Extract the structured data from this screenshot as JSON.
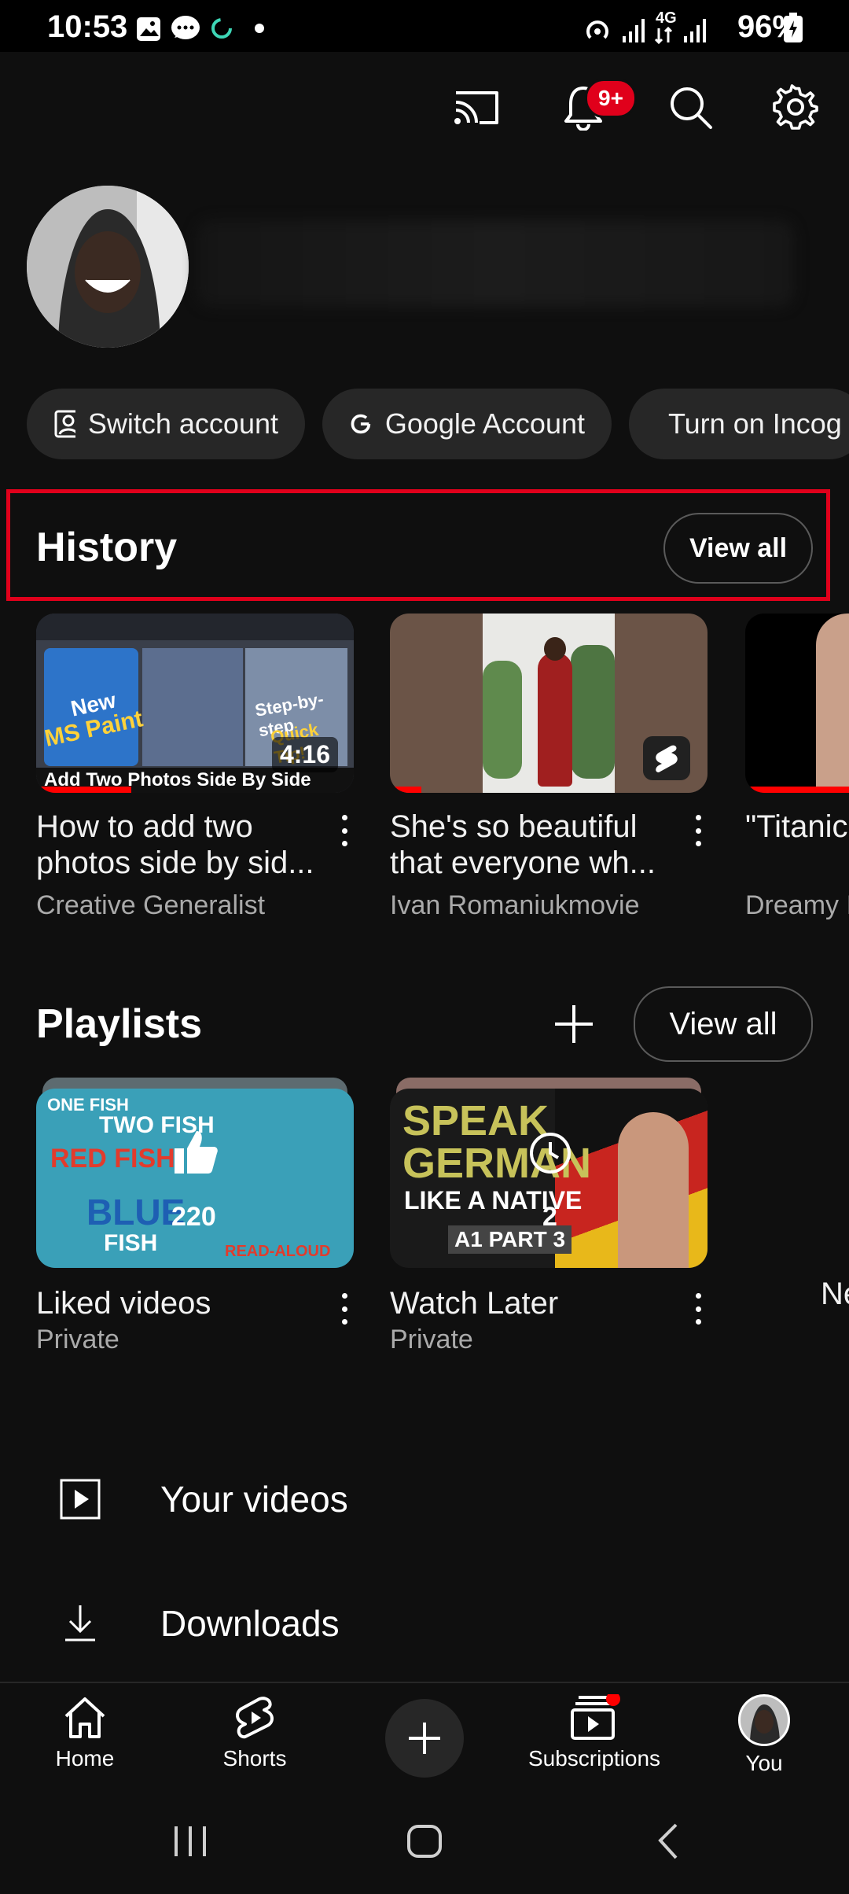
{
  "status_bar": {
    "time": "10:53",
    "battery": "96%",
    "network": "4G"
  },
  "top_bar": {
    "notification_badge": "9+"
  },
  "account_chips": [
    {
      "label": "Switch account",
      "icon": "person-card-icon"
    },
    {
      "label": "Google Account",
      "icon": "google-g-icon"
    },
    {
      "label": "Turn on Incog",
      "icon": "incognito-icon"
    }
  ],
  "history": {
    "title": "History",
    "view_all": "View all",
    "items": [
      {
        "title": "How to add two photos side by sid...",
        "channel": "Creative Generalist",
        "duration": "4:16",
        "progress": 0.3,
        "thumb_texts": {
          "line1": "New",
          "line2": "MS Paint",
          "line3": "Step-by-step",
          "line4": "Quick Tip!",
          "caption": "Add Two Photos Side By Side"
        }
      },
      {
        "title": "She's so beautiful that everyone wh...",
        "channel": "Ivan Romaniukmovie",
        "progress": 0.1
      },
      {
        "title": "\"Titanic screen\"",
        "channel": "Dreamy I"
      }
    ]
  },
  "playlists": {
    "title": "Playlists",
    "view_all": "View all",
    "items": [
      {
        "title": "Liked videos",
        "privacy": "Private",
        "count": "220",
        "thumb_texts": {
          "l1": "ONE FISH",
          "l2": "TWO FISH",
          "l3": "RED FISH",
          "l4": "BLUE",
          "l5": "FISH",
          "l6": "READ-ALOUD"
        }
      },
      {
        "title": "Watch Later",
        "privacy": "Private",
        "count": "2",
        "thumb_texts": {
          "l1": "SPEAK",
          "l2": "GERMAN",
          "l3": "LIKE A NATIVE",
          "l4": "A1 PART 3"
        }
      },
      {
        "title": "Ne"
      }
    ]
  },
  "menu": [
    {
      "label": "Your videos",
      "icon": "play-square-icon"
    },
    {
      "label": "Downloads",
      "icon": "download-icon"
    }
  ],
  "bottom_nav": [
    {
      "label": "Home",
      "icon": "home-icon"
    },
    {
      "label": "Shorts",
      "icon": "shorts-icon"
    },
    {
      "label": "",
      "icon": "create-plus-icon"
    },
    {
      "label": "Subscriptions",
      "icon": "subscriptions-icon"
    },
    {
      "label": "You",
      "icon": "avatar"
    }
  ],
  "colors": {
    "background": "#0f0f0f",
    "accent_red": "#ff0000",
    "chip_bg": "#272727",
    "secondary_text": "#aaaaaa"
  }
}
